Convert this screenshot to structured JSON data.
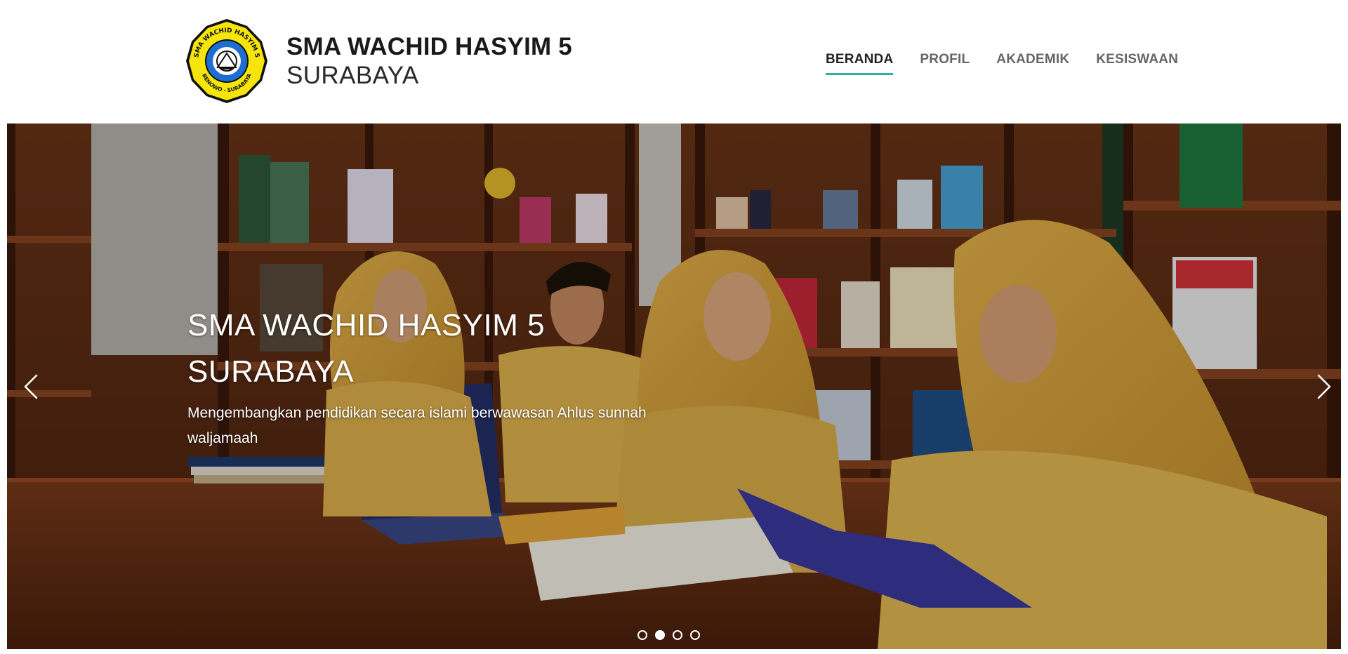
{
  "brand": {
    "name": "SMA WACHID HASYIM 5",
    "city": "SURABAYA",
    "logo_ring_top": "SMA WACHID HASYIM 5",
    "logo_ring_bottom": "BENOWO - SURABAYA"
  },
  "nav": {
    "items": [
      {
        "label": "BERANDA"
      },
      {
        "label": "PROFIL"
      },
      {
        "label": "AKADEMIK"
      },
      {
        "label": "KESISWAAN"
      }
    ],
    "active_label": "BERANDA"
  },
  "slider": {
    "caption_title_line1": "SMA WACHID HASYIM 5",
    "caption_title_line2": "SURABAYA",
    "caption_text": "Mengembangkan pendidikan secara islami berwawasan Ahlus sunnah waljamaah",
    "prev_icon": "chevron-left-icon",
    "next_icon": "chevron-right-icon",
    "indicator_count": 4,
    "active_indicator": 2
  },
  "colors": {
    "accent": "#2bb5a0",
    "nav_text": "#666666",
    "nav_active_text": "#222222",
    "logo_yellow": "#f5e50a",
    "logo_blue": "#1c6fd1"
  }
}
